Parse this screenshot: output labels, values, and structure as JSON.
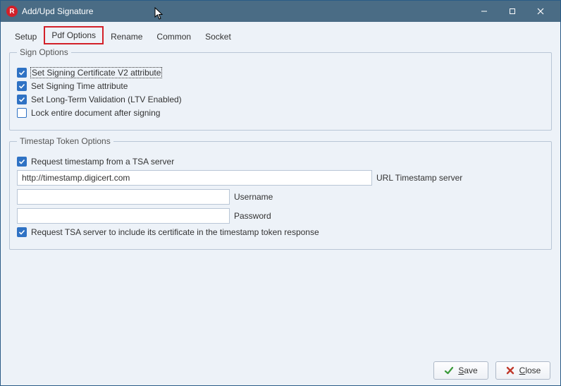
{
  "window": {
    "title": "Add/Upd Signature"
  },
  "tabs": {
    "setup": "Setup",
    "pdf_options": "Pdf Options",
    "rename": "Rename",
    "common": "Common",
    "socket": "Socket"
  },
  "sign_options": {
    "legend": "Sign Options",
    "cert_v2": {
      "label": "Set Signing Certificate V2 attribute",
      "checked": true
    },
    "sign_time": {
      "label": "Set Signing Time attribute",
      "checked": true
    },
    "ltv": {
      "label": "Set Long-Term Validation (LTV Enabled)",
      "checked": true
    },
    "lock_doc": {
      "label": "Lock entire document after signing",
      "checked": false
    }
  },
  "timestamp_options": {
    "legend": "Timestap Token Options",
    "request_tsa": {
      "label": "Request timestamp from a TSA server",
      "checked": true
    },
    "url": {
      "label": "URL Timestamp server",
      "value": "http://timestamp.digicert.com"
    },
    "username": {
      "label": "Username",
      "value": ""
    },
    "password": {
      "label": "Password",
      "value": ""
    },
    "include_cert": {
      "label": "Request TSA server to include its certificate in the timestamp token response",
      "checked": true
    }
  },
  "footer": {
    "save": "Save",
    "close": "Close"
  }
}
